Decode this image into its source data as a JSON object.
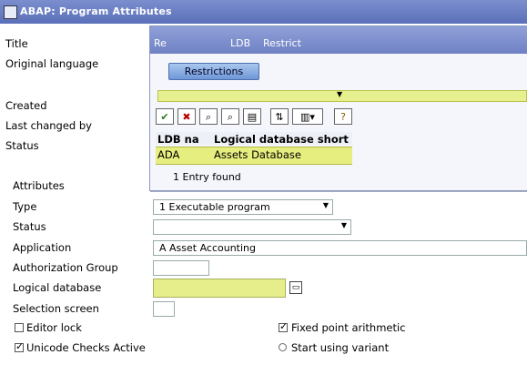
{
  "window": {
    "title": "ABAP: Program Attributes"
  },
  "left_labels": {
    "title": "Title",
    "original_language": "Original language",
    "created": "Created",
    "last_changed_by": "Last changed by",
    "status": "Status"
  },
  "dialog": {
    "title_parts": [
      "Re",
      "LDB",
      "Restrict"
    ],
    "restrict_button": "Restrictions",
    "toolbar_icons": [
      "check-icon",
      "cancel-icon",
      "search-icon",
      "search-next-icon",
      "filter-icon",
      "sort-icon",
      "print-icon",
      "help-icon"
    ],
    "columns": [
      "LDB na",
      "Logical database short"
    ],
    "rows": [
      {
        "ldb": "ADA",
        "desc": "Assets Database"
      }
    ],
    "entry_count": "1 Entry found"
  },
  "attributes": {
    "heading": "Attributes",
    "type_label": "Type",
    "type_value": "1 Executable program",
    "status_label": "Status",
    "status_value": "",
    "application_label": "Application",
    "application_value": "A Asset Accounting",
    "auth_group_label": "Authorization Group",
    "auth_group_value": "",
    "logical_db_label": "Logical database",
    "logical_db_value": "",
    "selection_screen_label": "Selection screen",
    "selection_screen_value": "",
    "editor_lock_label": "Editor lock",
    "fixed_point_label": "Fixed point arithmetic",
    "unicode_label": "Unicode Checks Active",
    "start_variant_label": "Start using variant"
  }
}
